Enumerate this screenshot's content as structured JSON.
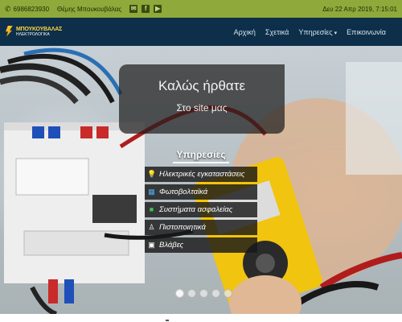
{
  "topbar": {
    "phone": "6986823930",
    "owner": "Θέμης Μπουκουβάλας",
    "social": [
      "email-icon",
      "facebook-icon",
      "youtube-icon"
    ],
    "datetime": "Δευ 22 Απρ 2019, 7:15:01",
    "background_color": "#8fa93a"
  },
  "navbar": {
    "logo_title": "ΜΠΟΥΚΟΥΒΑΛΑΣ",
    "logo_subtitle": "ΗΛΕΚΤΡΟΛΟΓΙΚΑ",
    "menu": {
      "home": "Αρχική",
      "about": "Σχετικά",
      "services": "Υπηρεσίες",
      "contact": "Επικοινωνία"
    },
    "background_color": "#0d2f4a"
  },
  "hero": {
    "welcome_title": "Καλώς ήρθατε",
    "welcome_subtitle": "Στο site μας",
    "services_heading": "Υπηρεσίες",
    "services": [
      {
        "label": "Ηλεκτρικές εγκαταστάσεις",
        "icon": "bulb-icon",
        "icon_color": "#ffd43b"
      },
      {
        "label": "Φωτοβολταϊκά",
        "icon": "solar-panel-icon",
        "icon_color": "#4dabf7"
      },
      {
        "label": "Συστήματα ασφαλείας",
        "icon": "camera-icon",
        "icon_color": "#40c057"
      },
      {
        "label": "Πιστοποιητικά",
        "icon": "certificate-icon",
        "icon_color": "#ffffff"
      },
      {
        "label": "Βλάβες",
        "icon": "toolbox-icon",
        "icon_color": "#ffffff"
      }
    ],
    "slide_count": 5,
    "active_slide": 1
  }
}
